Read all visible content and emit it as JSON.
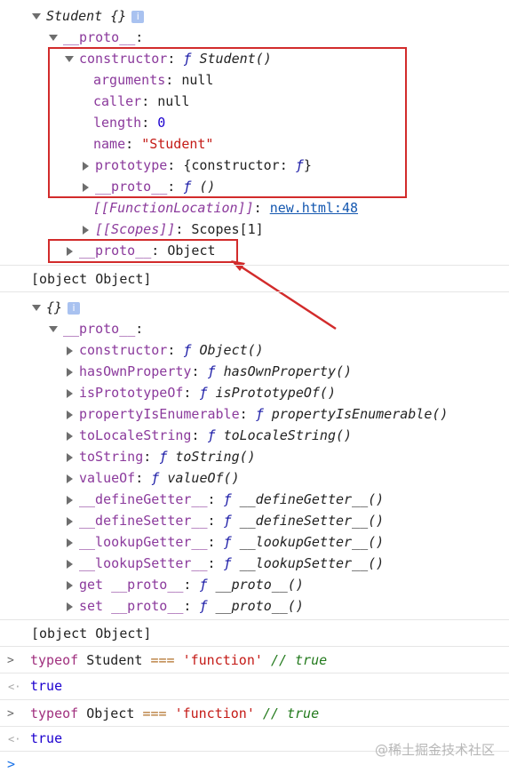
{
  "tree1": {
    "root": {
      "label": "Student {}",
      "badge": "i"
    },
    "proto_label": "__proto__",
    "constructor": {
      "key": "constructor",
      "f": "ƒ",
      "value": "Student()"
    },
    "arguments": {
      "key": "arguments",
      "value": "null"
    },
    "caller": {
      "key": "caller",
      "value": "null"
    },
    "length": {
      "key": "length",
      "value": "0"
    },
    "name": {
      "key": "name",
      "value": "\"Student\""
    },
    "prototype": {
      "key": "prototype",
      "value": "{constructor: ",
      "f": "ƒ",
      "tail": "}"
    },
    "inner_proto": {
      "key": "__proto__",
      "f": "ƒ",
      "value": "()"
    },
    "function_location": {
      "key": "[[FunctionLocation]]",
      "value": "new.html:48"
    },
    "scopes": {
      "key": "[[Scopes]]",
      "value": "Scopes[1]"
    },
    "outer_proto": {
      "key": "__proto__",
      "value": "Object"
    }
  },
  "output1": "[object Object]",
  "tree2": {
    "root": {
      "label": "{}",
      "badge": "i"
    },
    "proto_label": "__proto__",
    "items": [
      {
        "key": "constructor",
        "value": "Object()"
      },
      {
        "key": "hasOwnProperty",
        "value": "hasOwnProperty()"
      },
      {
        "key": "isPrototypeOf",
        "value": "isPrototypeOf()"
      },
      {
        "key": "propertyIsEnumerable",
        "value": "propertyIsEnumerable()"
      },
      {
        "key": "toLocaleString",
        "value": "toLocaleString()"
      },
      {
        "key": "toString",
        "value": "toString()"
      },
      {
        "key": "valueOf",
        "value": "valueOf()"
      },
      {
        "key": "__defineGetter__",
        "value": "__defineGetter__()"
      },
      {
        "key": "__defineSetter__",
        "value": "__defineSetter__()"
      },
      {
        "key": "__lookupGetter__",
        "value": "__lookupGetter__()"
      },
      {
        "key": "__lookupSetter__",
        "value": "__lookupSetter__()"
      },
      {
        "key": "get __proto__",
        "value": "__proto__()"
      },
      {
        "key": "set __proto__",
        "value": "__proto__()"
      }
    ],
    "f": "ƒ"
  },
  "output2": "[object Object]",
  "console": {
    "cmd1": {
      "kw": "typeof",
      "ident": "Student",
      "op": "===",
      "str": "'function'",
      "cmt": "// true"
    },
    "res1": "true",
    "cmd2": {
      "kw": "typeof",
      "ident": "Object",
      "op": "===",
      "str": "'function'",
      "cmt": "// true"
    },
    "res2": "true",
    "prompt_symbol": ">",
    "result_symbol": "<·"
  },
  "watermark": "@稀土掘金技术社区",
  "colors": {
    "annotation_red": "#d22b2b"
  }
}
